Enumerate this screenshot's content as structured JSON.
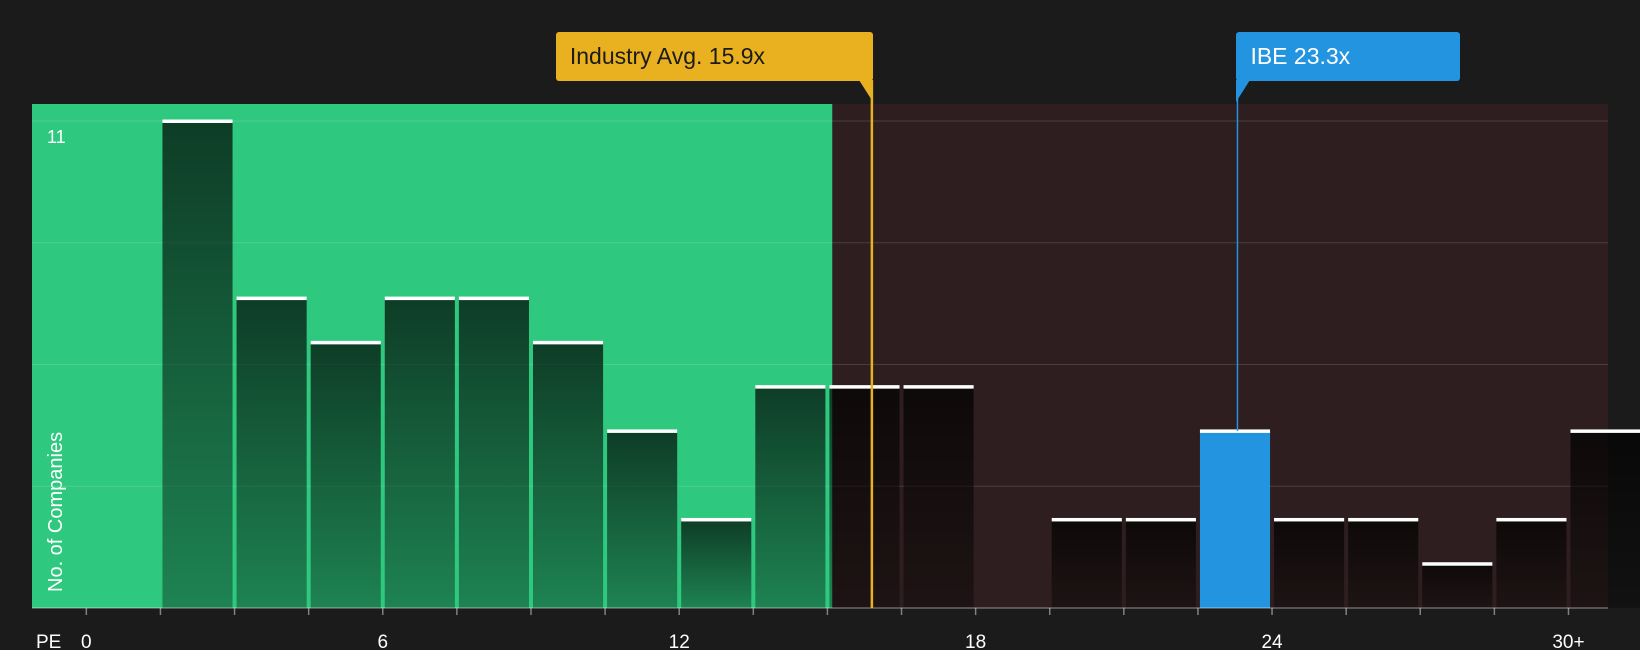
{
  "chart_data": {
    "type": "bar",
    "xlabel": "PE",
    "ylabel": "No. of Companies",
    "x_ticks": [
      {
        "value": 0,
        "label": "0"
      },
      {
        "value": 6,
        "label": "6"
      },
      {
        "value": 12,
        "label": "12"
      },
      {
        "value": 18,
        "label": "18"
      },
      {
        "value": 24,
        "label": "24"
      },
      {
        "value": 30,
        "label": "30+"
      }
    ],
    "xlim": [
      -1.1,
      30.8
    ],
    "ylim": [
      0,
      11
    ],
    "y_ticks": [
      {
        "value": 11,
        "label": "11"
      }
    ],
    "grid": true,
    "bin_width": 1.5,
    "bins": [
      {
        "x0": 1.5,
        "count": 11
      },
      {
        "x0": 3.0,
        "count": 7
      },
      {
        "x0": 4.5,
        "count": 6
      },
      {
        "x0": 6.0,
        "count": 7
      },
      {
        "x0": 7.5,
        "count": 7
      },
      {
        "x0": 9.0,
        "count": 6
      },
      {
        "x0": 10.5,
        "count": 4
      },
      {
        "x0": 12.0,
        "count": 2
      },
      {
        "x0": 13.5,
        "count": 5
      },
      {
        "x0": 15.0,
        "count": 5
      },
      {
        "x0": 16.5,
        "count": 5
      },
      {
        "x0": 18.0,
        "count": 0
      },
      {
        "x0": 19.5,
        "count": 2
      },
      {
        "x0": 21.0,
        "count": 2
      },
      {
        "x0": 22.5,
        "count": 4,
        "highlight": true
      },
      {
        "x0": 24.0,
        "count": 2
      },
      {
        "x0": 25.5,
        "count": 2
      },
      {
        "x0": 27.0,
        "count": 1
      },
      {
        "x0": 28.5,
        "count": 2
      },
      {
        "x0": 30.0,
        "count": 4
      }
    ],
    "fair_zone_end": 15.1,
    "industry_avg": {
      "value": 15.9,
      "label": "Industry Avg. 15.9x",
      "color": "#e9b11f"
    },
    "company": {
      "value": 23.3,
      "label": "IBE 23.3x",
      "color": "#2394e0"
    },
    "colors": {
      "background": "#1b1b1b",
      "fair_zone": "#2ec97e",
      "expensive_zone": "#2e1e1f",
      "bar_top": "#ffffff",
      "highlight": "#2394e0"
    }
  }
}
